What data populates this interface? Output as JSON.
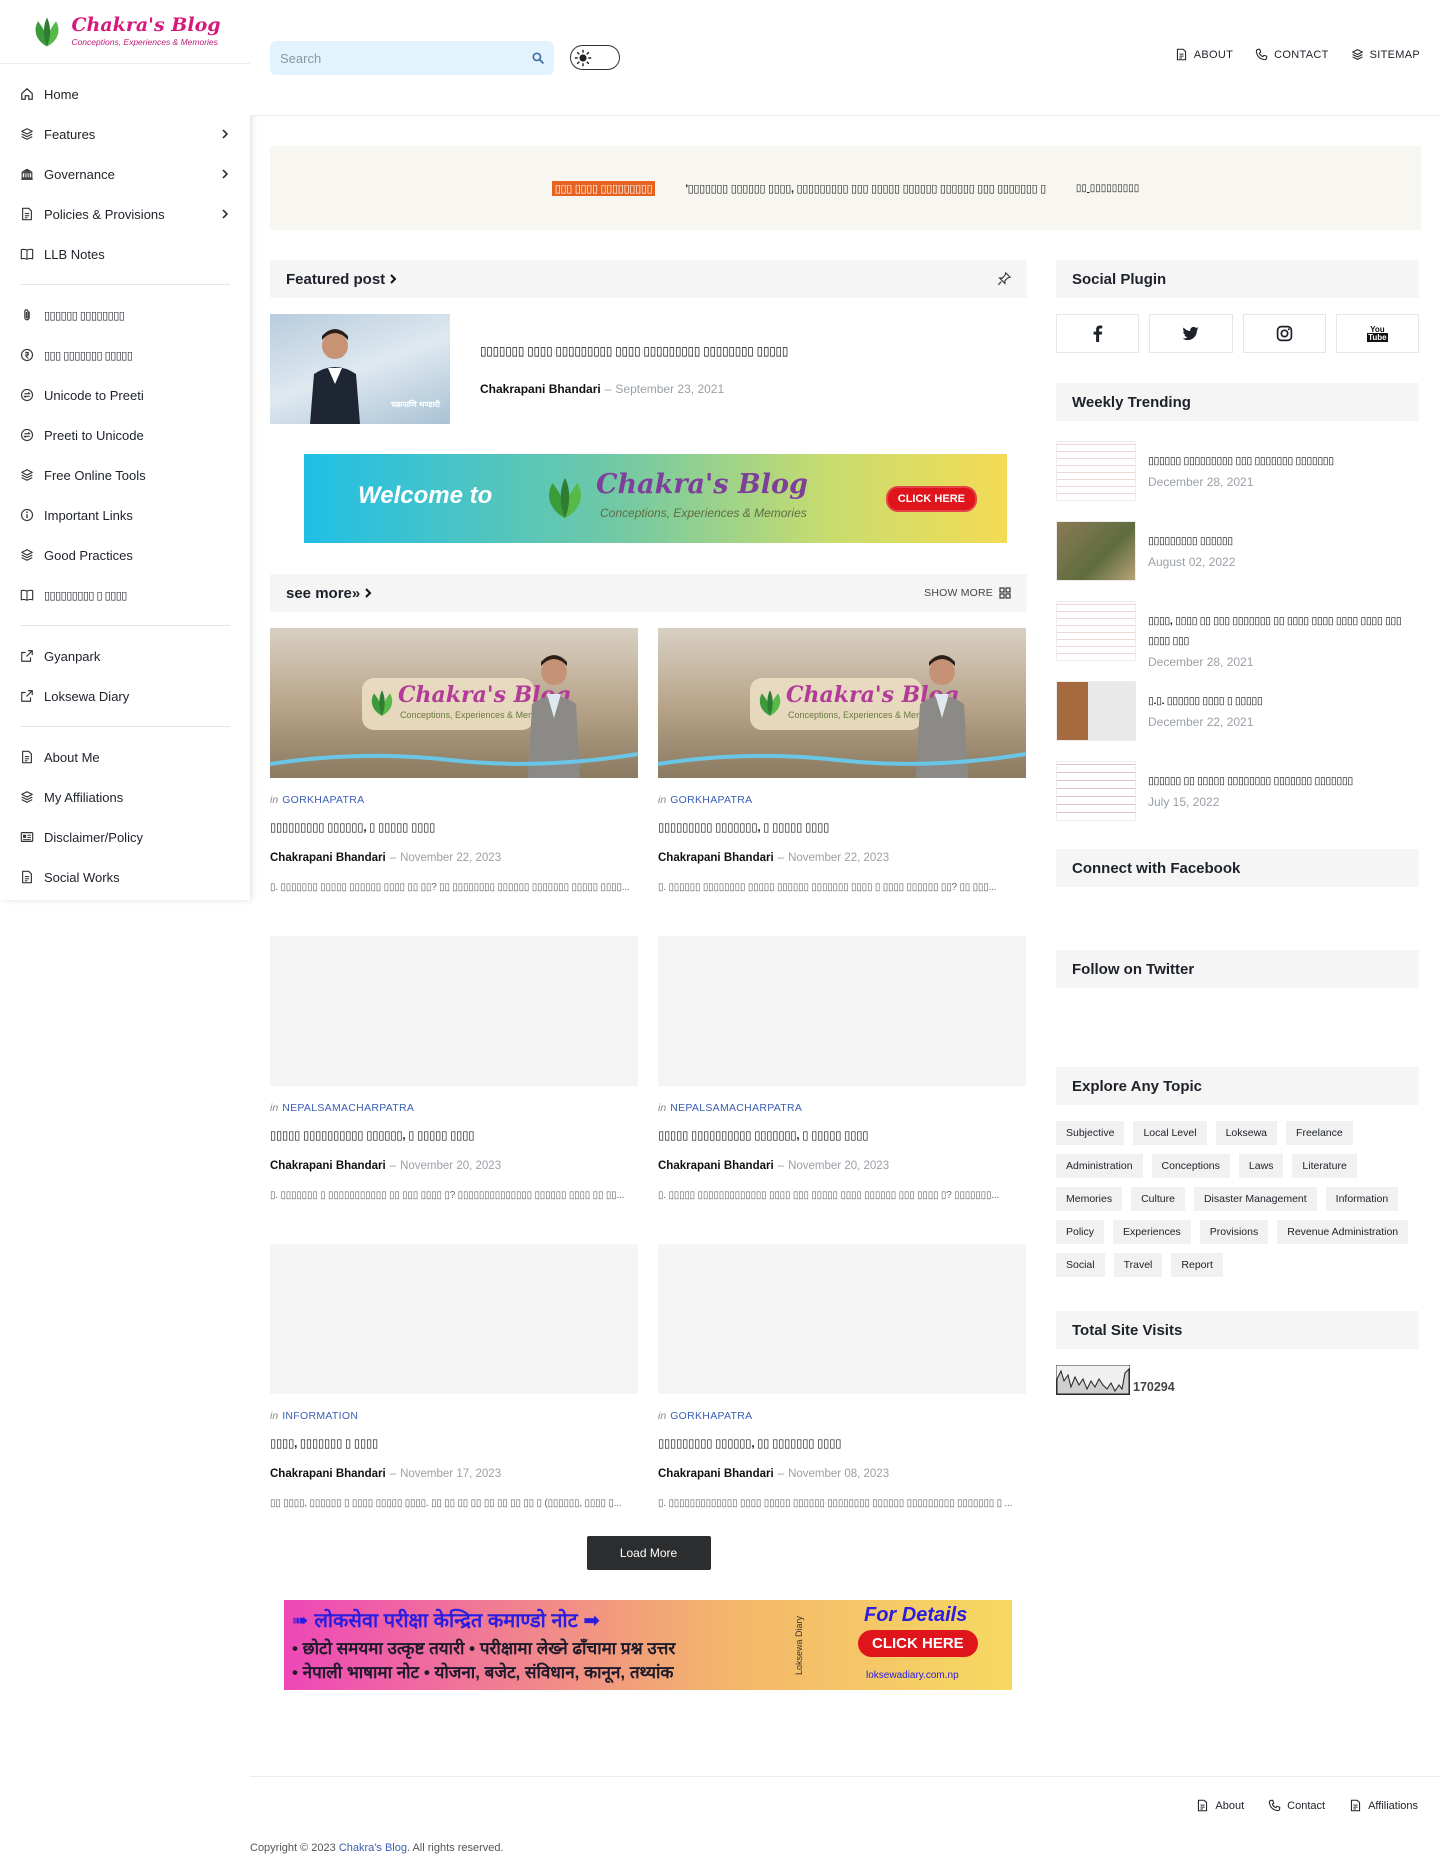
{
  "brand": {
    "name": "Chakra's Blog",
    "tagline": "Conceptions, Experiences & Memories",
    "colors": {
      "accent": "#d6197a",
      "link": "#3b5fb5",
      "ticker_label": "#e8621f"
    }
  },
  "sidebar": {
    "groups": [
      [
        {
          "label": "Home",
          "icon": "home-icon",
          "has_submenu": false
        },
        {
          "label": "Features",
          "icon": "layers-icon",
          "has_submenu": true
        },
        {
          "label": "Governance",
          "icon": "bank-icon",
          "has_submenu": true
        },
        {
          "label": "Policies & Provisions",
          "icon": "document-icon",
          "has_submenu": true
        },
        {
          "label": "LLB Notes",
          "icon": "book-icon",
          "has_submenu": false
        }
      ],
      [
        {
          "label": "▯▯▯▯▯▯ ▯▯▯▯▯▯▯▯",
          "icon": "clip-icon",
          "has_submenu": false
        },
        {
          "label": "▯▯▯ ▯▯▯▯▯▯▯ ▯▯▯▯▯",
          "icon": "currency-icon",
          "has_submenu": false
        },
        {
          "label": "Unicode to Preeti",
          "icon": "convert-icon",
          "has_submenu": false
        },
        {
          "label": "Preeti to Unicode",
          "icon": "convert-icon",
          "has_submenu": false
        },
        {
          "label": "Free Online Tools",
          "icon": "layers-icon",
          "has_submenu": false
        },
        {
          "label": "Important Links",
          "icon": "info-icon",
          "has_submenu": false
        },
        {
          "label": "Good Practices",
          "icon": "layers-icon",
          "has_submenu": false
        },
        {
          "label": "▯▯▯▯▯▯▯▯▯ ▯ ▯▯▯▯",
          "icon": "book-icon",
          "has_submenu": false
        }
      ],
      [
        {
          "label": "Gyanpark",
          "icon": "external-link-icon",
          "has_submenu": false
        },
        {
          "label": "Loksewa Diary",
          "icon": "external-link-icon",
          "has_submenu": false
        }
      ],
      [
        {
          "label": "About Me",
          "icon": "document-icon",
          "has_submenu": false
        },
        {
          "label": "My Affiliations",
          "icon": "layers-icon",
          "has_submenu": false
        },
        {
          "label": "Disclaimer/Policy",
          "icon": "card-icon",
          "has_submenu": false
        },
        {
          "label": "Social Works",
          "icon": "document-icon",
          "has_submenu": false
        }
      ]
    ]
  },
  "header": {
    "search": {
      "placeholder": "Search",
      "value": ""
    },
    "links": [
      {
        "label": "ABOUT",
        "icon": "document-icon"
      },
      {
        "label": "CONTACT",
        "icon": "phone-icon"
      },
      {
        "label": "SITEMAP",
        "icon": "layers-icon"
      }
    ]
  },
  "ticker": {
    "label": "▯▯▯ ▯▯▯▯ ▯▯▯▯▯▯▯▯▯",
    "text": "'▯▯▯▯▯▯▯ ▯▯▯▯▯▯ ▯▯▯▯, ▯▯▯▯▯▯▯▯▯ ▯▯▯ ▯▯▯▯▯ ▯▯▯▯▯▯ ▯▯▯▯▯▯ ▯▯▯ ▯▯▯▯▯▯▯ ▯",
    "more": "▯▯ ▯▯▯▯▯▯▯▯▯"
  },
  "featured": {
    "heading": "Featured post",
    "title": "▯▯▯▯▯▯▯ ▯▯▯▯ ▯▯▯▯▯▯▯▯▯ ▯▯▯▯ ▯▯▯▯▯▯▯▯▯ ▯▯▯▯▯▯▯▯ ▯▯▯▯▯",
    "author": "Chakrapani Bhandari",
    "date": "September 23, 2021",
    "thumb_caption": "चक्रपाणि भण्डारी"
  },
  "welcome_banner": {
    "welcome": "Welcome to",
    "brand": "Chakra's Blog",
    "tagline": "Conceptions, Experiences & Memories",
    "button": "CLICK HERE"
  },
  "more_section": {
    "heading": "see more»",
    "show_more": "SHOW MORE"
  },
  "posts": [
    {
      "label": "GORKHAPATRA",
      "title": "▯▯▯▯▯▯▯▯▯ ▯▯▯▯▯▯, ▯ ▯▯▯▯▯ ▯▯▯▯",
      "author": "Chakrapani Bhandari",
      "date": "November 22, 2023",
      "snippet": "▯. ▯▯▯▯▯▯▯ ▯▯▯▯▯ ▯▯▯▯▯▯ ▯▯▯▯ ▯▯ ▯▯? ▯▯ ▯▯▯▯▯▯▯▯ ▯▯▯▯▯▯ ▯▯▯▯▯▯▯ ▯▯▯▯▯ ▯▯▯▯...",
      "image": true
    },
    {
      "label": "GORKHAPATRA",
      "title": "▯▯▯▯▯▯▯▯▯ ▯▯▯▯▯▯▯, ▯ ▯▯▯▯▯ ▯▯▯▯",
      "author": "Chakrapani Bhandari",
      "date": "November 22, 2023",
      "snippet": "▯. ▯▯▯▯▯▯ ▯▯▯▯▯▯▯▯ ▯▯▯▯▯ ▯▯▯▯▯▯ ▯▯▯▯▯▯▯ ▯▯▯▯ ▯ ▯▯▯▯ ▯▯▯▯▯▯ ▯▯?  ▯▯ ▯▯▯...",
      "image": true
    },
    {
      "label": "NEPALSAMACHARPATRA",
      "title": "▯▯▯▯▯ ▯▯▯▯▯▯▯▯▯▯ ▯▯▯▯▯▯, ▯ ▯▯▯▯▯ ▯▯▯▯",
      "author": "Chakrapani Bhandari",
      "date": "November 20, 2023",
      "snippet": "▯. ▯▯▯▯▯▯▯ ▯ ▯▯▯▯▯▯▯▯▯▯▯ ▯▯ ▯▯▯ ▯▯▯▯ ▯? ▯▯▯▯▯▯▯▯▯▯▯▯▯▯ ▯▯▯▯▯▯ ▯▯▯▯ ▯▯ ▯▯...",
      "image": false
    },
    {
      "label": "NEPALSAMACHARPATRA",
      "title": "▯▯▯▯▯ ▯▯▯▯▯▯▯▯▯▯ ▯▯▯▯▯▯▯, ▯ ▯▯▯▯▯ ▯▯▯▯",
      "author": "Chakrapani Bhandari",
      "date": "November 20, 2023",
      "snippet": "▯. ▯▯▯▯▯ ▯▯▯▯▯▯▯▯▯▯▯▯▯ ▯▯▯▯ ▯▯▯ ▯▯▯▯▯ ▯▯▯▯ ▯▯▯▯▯▯ ▯▯▯ ▯▯▯▯ ▯? ▯▯▯▯▯▯▯...",
      "image": false
    },
    {
      "label": "INFORMATION",
      "title": "▯▯▯▯, ▯▯▯▯▯▯▯ ▯ ▯▯▯▯",
      "author": "Chakrapani Bhandari",
      "date": "November 17, 2023",
      "snippet": "▯▯ ▯▯▯▯, ▯▯▯▯▯▯ ▯ ▯▯▯▯ ▯▯▯▯▯ ▯▯▯▯. ▯▯ ▯▯ ▯▯ ▯▯ ▯▯ ▯▯ ▯▯ ▯▯ ▯ (▯▯▯▯▯▯, ▯▯▯▯ ▯...",
      "image": false
    },
    {
      "label": "GORKHAPATRA",
      "title": "▯▯▯▯▯▯▯▯▯ ▯▯▯▯▯▯, ▯▯ ▯▯▯▯▯▯▯ ▯▯▯▯",
      "author": "Chakrapani Bhandari",
      "date": "November 08, 2023",
      "snippet": "▯. ▯▯▯▯▯▯▯▯▯▯▯▯▯ ▯▯▯▯ ▯▯▯▯▯ ▯▯▯▯▯▯ ▯▯▯▯▯▯▯▯ ▯▯▯▯▯▯ ▯▯▯▯▯▯▯▯▯ ▯▯▯▯▯▯▯ ▯ ...",
      "image": false
    }
  ],
  "load_more": "Load More",
  "loksewa_banner": {
    "line1": "➠ लोकसेवा परीक्षा केन्द्रित कमाण्डो नोट ➡",
    "line2": "• छोटो समयमा उत्कृष्ट तयारी  • परीक्षामा लेख्ने ढाँचामा प्रश्न उत्तर",
    "line3": "• नेपाली भाषामा नोट          • योजना, बजेट, संविधान, कानून, तथ्यांक",
    "vertical": "Loksewa Diary",
    "details": "For Details",
    "button": "CLICK HERE",
    "url": "loksewadiary.com.np"
  },
  "aside": {
    "social_heading": "Social Plugin",
    "social": [
      {
        "name": "facebook",
        "icon": "facebook-icon"
      },
      {
        "name": "twitter",
        "icon": "twitter-icon"
      },
      {
        "name": "instagram",
        "icon": "instagram-icon"
      },
      {
        "name": "youtube",
        "icon": "youtube-icon",
        "text": "You\nTube"
      }
    ],
    "trending_heading": "Weekly Trending",
    "trending": [
      {
        "title": "▯▯▯▯▯▯ ▯▯▯▯▯▯▯▯▯ ▯▯▯ ▯▯▯▯▯▯▯ ▯▯▯▯▯▯▯",
        "date": "December 28, 2021"
      },
      {
        "title": "▯▯▯▯▯▯▯▯▯ ▯▯▯▯▯▯",
        "date": "August 02, 2022"
      },
      {
        "title": "▯▯▯▯, ▯▯▯▯ ▯▯ ▯▯▯ ▯▯▯▯▯▯▯ ▯▯ ▯▯▯▯ ▯▯▯▯ ▯▯▯▯ ▯▯▯▯ ▯▯▯ ▯▯▯▯ ▯▯▯",
        "date": "December 28, 2021"
      },
      {
        "title": "▯.▯. ▯▯▯▯▯▯ ▯▯▯▯ ▯ ▯▯▯▯▯",
        "date": "December 22, 2021"
      },
      {
        "title": "▯▯▯▯▯▯ ▯▯ ▯▯▯▯▯ ▯▯▯▯▯▯▯▯ ▯▯▯▯▯▯▯ ▯▯▯▯▯▯▯",
        "date": "July 15, 2022"
      }
    ],
    "facebook_heading": "Connect with Facebook",
    "twitter_heading": "Follow on Twitter",
    "topics_heading": "Explore Any Topic",
    "topics": [
      "Subjective",
      "Local Level",
      "Loksewa",
      "Freelance",
      "Administration",
      "Conceptions",
      "Laws",
      "Literature",
      "Memories",
      "Culture",
      "Disaster Management",
      "Information",
      "Policy",
      "Experiences",
      "Provisions",
      "Revenue Administration",
      "Social",
      "Travel",
      "Report"
    ],
    "visits_heading": "Total Site Visits",
    "visits": "170294"
  },
  "footer": {
    "links": [
      {
        "label": "About",
        "icon": "document-icon"
      },
      {
        "label": "Contact",
        "icon": "phone-icon"
      },
      {
        "label": "Affiliations",
        "icon": "document-icon"
      }
    ],
    "copyright_prefix": "Copyright © 2023",
    "copyright_brand": "Chakra's Blog",
    "copyright_suffix": ". All rights reserved."
  }
}
